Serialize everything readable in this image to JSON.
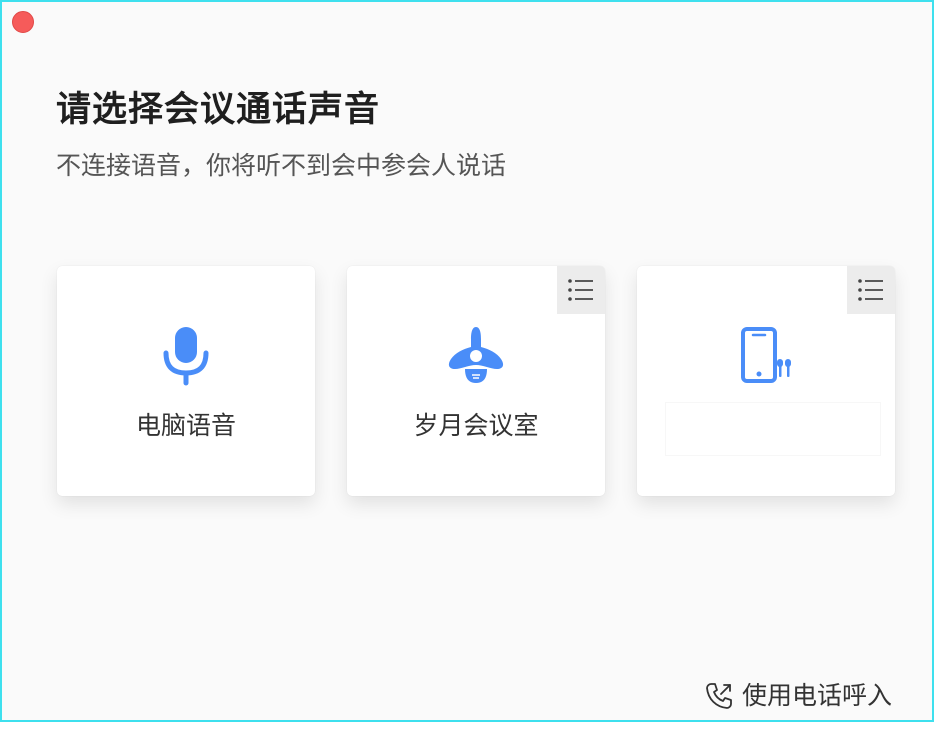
{
  "window": {
    "title": "请选择会议通话声音",
    "subtitle": "不连接语音，你将听不到会中参会人说话"
  },
  "options": [
    {
      "id": "computer-audio",
      "label": "电脑语音",
      "icon": "microphone-icon",
      "has_list": false
    },
    {
      "id": "room-system",
      "label": "岁月会议室",
      "icon": "conference-speaker-icon",
      "has_list": true
    },
    {
      "id": "phone-audio",
      "label": "",
      "icon": "phone-earbuds-icon",
      "has_list": true
    }
  ],
  "footer": {
    "dial_in_label": "使用电话呼入",
    "icon": "phone-call-icon"
  },
  "colors": {
    "accent": "#4a8df8",
    "close": "#f65b5a",
    "border": "#3ee0ee"
  }
}
